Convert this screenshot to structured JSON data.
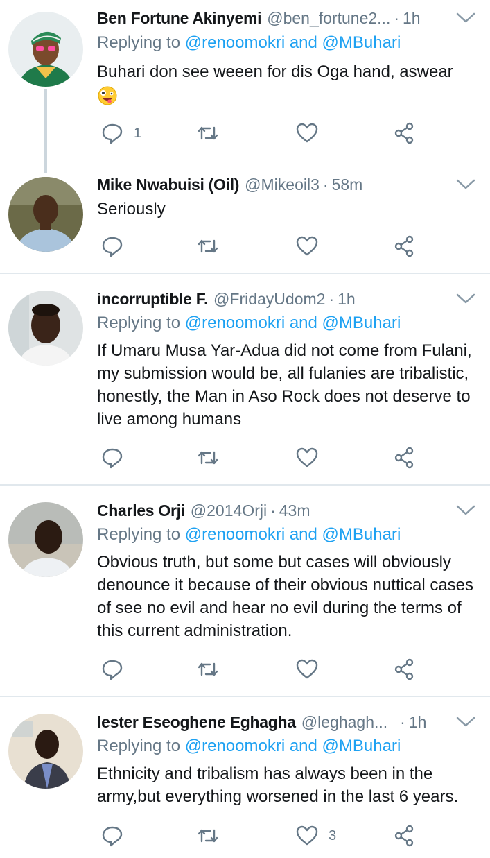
{
  "tweets": [
    {
      "name": "Ben Fortune Akinyemi",
      "handle": "@ben_fortune2...",
      "time": "1h",
      "replying_prefix": "Replying to",
      "mentions": "@renoomokri and @MBuhari",
      "text": "Buhari don see weeen for dis Oga hand, aswear",
      "emoji": "crazy-face-emoji",
      "reply_count": "1",
      "like_count": ""
    },
    {
      "name": "Mike Nwabuisi (Oil)",
      "handle": "@Mikeoil3",
      "time": "58m",
      "text": "Seriously",
      "reply_count": "",
      "like_count": ""
    },
    {
      "name": "incorruptible F.",
      "handle": "@FridayUdom2",
      "time": "1h",
      "replying_prefix": "Replying to",
      "mentions": "@renoomokri and @MBuhari",
      "text": "If Umaru Musa Yar-Adua  did not come from Fulani, my submission would be, all fulanies are tribalistic, honestly, the Man in Aso Rock does not deserve to live among humans",
      "reply_count": "",
      "like_count": ""
    },
    {
      "name": "Charles Orji",
      "handle": "@2014Orji",
      "time": "43m",
      "replying_prefix": "Replying to",
      "mentions": "@renoomokri and @MBuhari",
      "text": "Obvious truth, but some but cases will obviously denounce it because of their obvious nuttical cases of see no evil and hear no evil during the terms of this current administration.",
      "reply_count": "",
      "like_count": ""
    },
    {
      "name": "lester Eseoghene Eghagha",
      "handle": "@leghagh...",
      "time": "1h",
      "replying_prefix": "Replying to",
      "mentions": "@renoomokri and @MBuhari",
      "text": "Ethnicity and tribalism has always been in the army,but everything worsened in the last 6 years.",
      "reply_count": "",
      "like_count": "3"
    }
  ],
  "separator": "·",
  "colors": {
    "accent": "#1da1f2",
    "secondary": "#657786",
    "divider": "#e1e8ed"
  }
}
